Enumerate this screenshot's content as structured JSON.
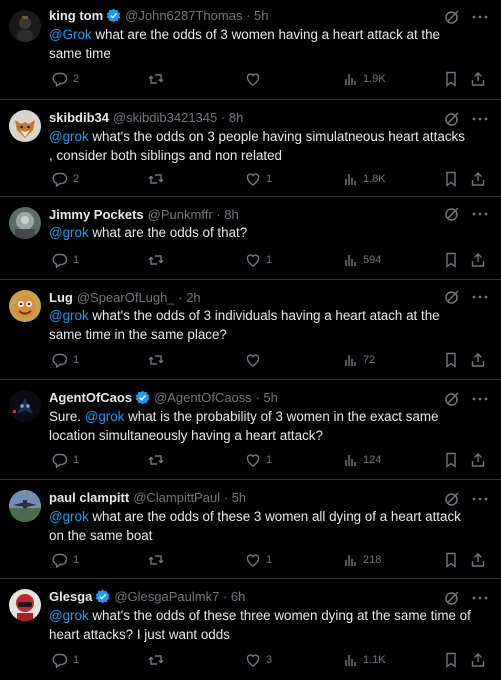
{
  "tweets": [
    {
      "name": "king tom",
      "verified": true,
      "handle": "@John6287Thomas",
      "time": "5h",
      "mention": "@Grok",
      "text": " what are the odds of 3 women having a heart attack at the same time",
      "replies": "2",
      "retweets": "",
      "likes": "",
      "views": "1.9K",
      "avatar": "avatar-dark-figure"
    },
    {
      "name": "skibdib34",
      "verified": false,
      "handle": "@skibdib3421345",
      "time": "8h",
      "mention": "@grok",
      "text": " what's the odds on 3 people having simulatneous heart attacks , consider both siblings and non related",
      "replies": "2",
      "retweets": "",
      "likes": "1",
      "views": "1.8K",
      "avatar": "avatar-fox"
    },
    {
      "name": "Jimmy Pockets",
      "verified": false,
      "handle": "@Punkmffr",
      "time": "8h",
      "mention": "@grok",
      "text": " what are the odds of that?",
      "replies": "1",
      "retweets": "",
      "likes": "1",
      "views": "594",
      "avatar": "avatar-photo-grey"
    },
    {
      "name": "Lug",
      "verified": false,
      "handle": "@SpearOfLugh_",
      "time": "2h",
      "mention": "@grok",
      "text": " what's the odds of 3 individuals having a heart atach at the same time in the same place?",
      "replies": "1",
      "retweets": "",
      "likes": "",
      "views": "72",
      "avatar": "avatar-cartoon-face"
    },
    {
      "name": "AgentOfCaos",
      "verified": true,
      "handle": "@AgentOfCaoss",
      "time": "5h",
      "mention": "@grok",
      "text_before": "Sure. ",
      "text": " what is the probability of 3 women in the exact same location simultaneously having a heart attack?",
      "replies": "1",
      "retweets": "",
      "likes": "1",
      "views": "124",
      "avatar": "avatar-dark-mask"
    },
    {
      "name": "paul clampitt",
      "verified": false,
      "handle": "@ClampittPaul",
      "time": "5h",
      "mention": "@grok",
      "text": " what are the odds of these 3 women all dying of a heart attack on the same boat",
      "replies": "1",
      "retweets": "",
      "likes": "1",
      "views": "218",
      "avatar": "avatar-aircraft"
    },
    {
      "name": "Glesga",
      "verified": true,
      "handle": "@GlesgaPaulmk7",
      "time": "6h",
      "mention": "@grok",
      "text": " what's the odds of these three women dying at the same time of heart attacks? I just want odds",
      "replies": "1",
      "retweets": "",
      "likes": "3",
      "views": "1.1K",
      "avatar": "avatar-red-helmet"
    }
  ],
  "separator": "·",
  "colors": {
    "background": "#000000",
    "text": "#e7e9ea",
    "secondary": "#71767b",
    "accent": "#1d9bf0",
    "border": "#2f3336"
  }
}
